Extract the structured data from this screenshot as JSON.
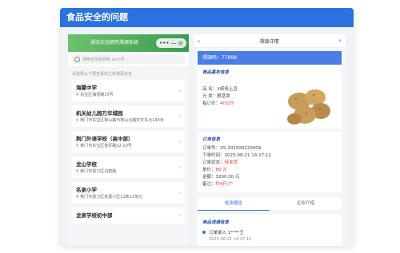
{
  "window": {
    "title": "食品安全的问题"
  },
  "left_phone": {
    "app_title": "湖北农谷楚辉溯源系统",
    "capsule": {
      "more": "•••",
      "minus": "—",
      "close": "◎"
    },
    "search_placeholder": "搜索全体名称和 xx小学",
    "hint": "请选择以下要查看的主体溯源信息",
    "schools": [
      {
        "name": "海慧中学",
        "address": "东宝区海慧路15号"
      },
      {
        "name": "机关幼儿园万华城园",
        "address": "荆门市东宝区钟山路与寿山北路交叉东北140米"
      },
      {
        "name": "荆门外语学校（高中部）",
        "address": "荆门市东宝区金虾路22-10号"
      },
      {
        "name": "龙山学校",
        "address": "荆门市掇刀区白鹤路"
      },
      {
        "name": "名泉小学",
        "address": "荆门市掇刀区安置小区11栋12单元"
      },
      {
        "name": "龙泉学校初中部",
        "address": ""
      }
    ]
  },
  "right_phone": {
    "nav_title": "溯源详情",
    "trace_code": "溯源码：77898",
    "product_section": "商品基本信息",
    "product": {
      "name": "品  名：X纸吸土豆",
      "category": "分  类：根茎类",
      "price_label": "指订价：",
      "price": "40公斤"
    },
    "order_section": "订单信息",
    "order": {
      "no": "订单号：XS-202508220009",
      "time": "下单时间：2025-08-21 14:27:12",
      "status_label": "订单状态：",
      "status": "待发货",
      "unit_label": "单价：",
      "unit": "80 元",
      "amount": "金额：3200.00 元",
      "note_label": "备注：",
      "note": "约4斤/个"
    },
    "tabs": [
      "检测报告",
      "企业介绍"
    ],
    "flow_section": "商品流通信息",
    "flow_items": [
      {
        "title": "订单录入 1****王",
        "time": "2025-08-21 14:27:12"
      }
    ]
  },
  "colors": {
    "accent": "#2a72e0",
    "brand_green": "#4caf50",
    "alert_red": "#e23b2e"
  }
}
